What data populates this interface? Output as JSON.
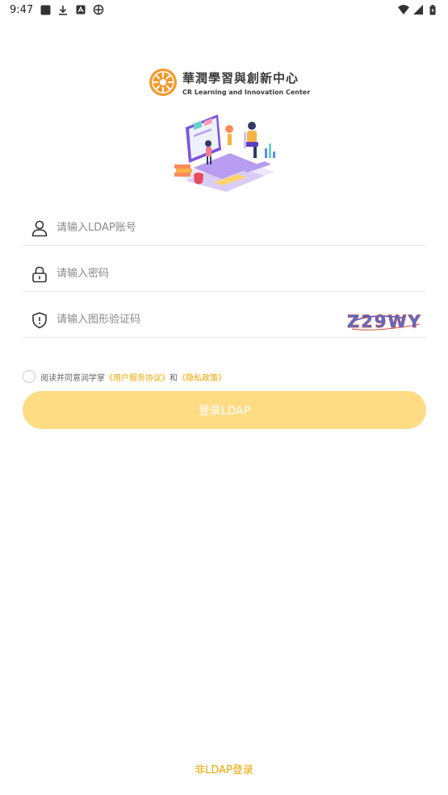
{
  "status_bar": {
    "time": "9:47",
    "icons_left": [
      "square-icon",
      "download-icon",
      "font-icon",
      "app-icon"
    ],
    "icons_right": [
      "wifi-icon",
      "signal-icon",
      "battery-icon"
    ]
  },
  "logo": {
    "name_cn": "華潤學習與創新中心",
    "name_en": "CR Learning and Innovation Center"
  },
  "form": {
    "username_placeholder": "请输入LDAP账号",
    "password_placeholder": "请输入密码",
    "captcha_placeholder": "请输入图形验证码",
    "captcha_text": "Z29WY"
  },
  "agreement": {
    "prefix": "阅读并同意润学掌",
    "user_agreement": "《用户服务协议》",
    "and": "和",
    "privacy_policy": "《隐私政策》"
  },
  "login_button": "登录LDAP",
  "alt_login": "非LDAP登录",
  "colors": {
    "accent": "#f0a500",
    "button_bg": "#fedc84",
    "logo_orange": "#f29a2e"
  }
}
